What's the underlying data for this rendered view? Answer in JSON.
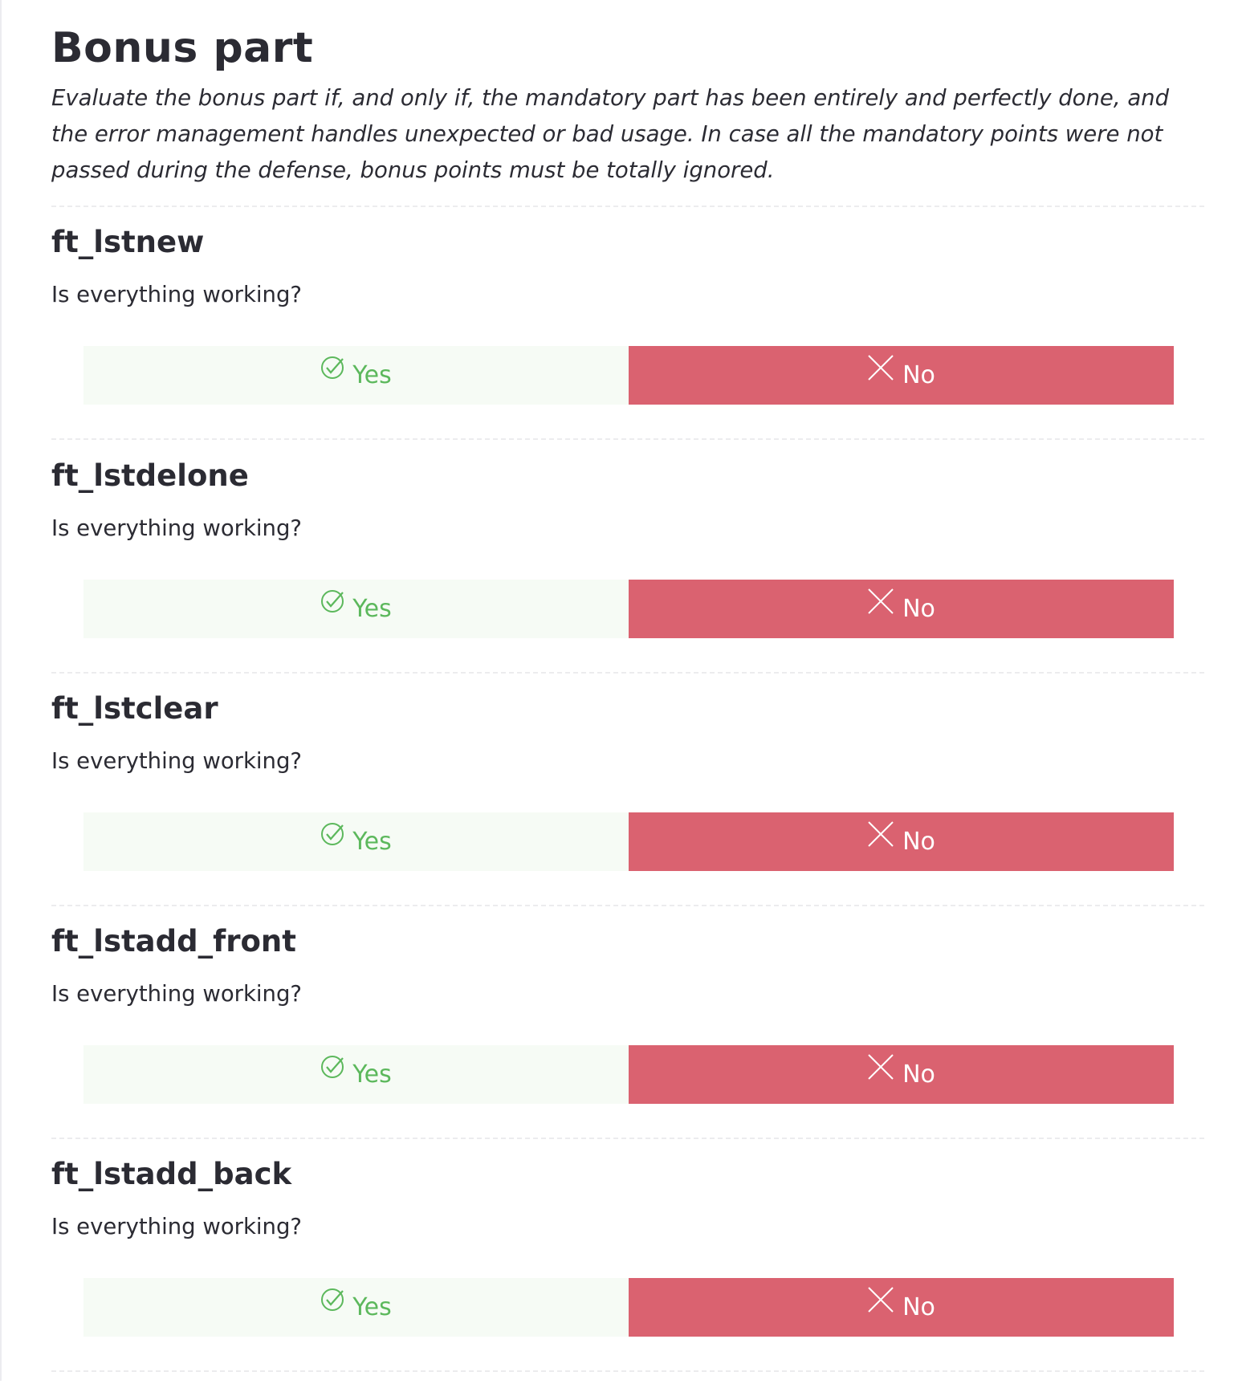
{
  "section": {
    "title": "Bonus part",
    "description": "Evaluate the bonus part if, and only if, the mandatory part has been entirely and perfectly done, and the error management handles unexpected or bad usage. In case all the mandatory points were not passed during the defense, bonus points must be totally ignored."
  },
  "questions": [
    {
      "title": "ft_lstnew",
      "text": "Is everything working?",
      "yes_label": "Yes",
      "no_label": "No",
      "yes_icon": "check-circle-icon",
      "no_icon": "close-x-icon"
    },
    {
      "title": "ft_lstdelone",
      "text": "Is everything working?",
      "yes_label": "Yes",
      "no_label": "No",
      "yes_icon": "check-circle-icon",
      "no_icon": "close-x-icon"
    },
    {
      "title": "ft_lstclear",
      "text": "Is everything working?",
      "yes_label": "Yes",
      "no_label": "No",
      "yes_icon": "check-circle-icon",
      "no_icon": "close-x-icon"
    },
    {
      "title": "ft_lstadd_front",
      "text": "Is everything working?",
      "yes_label": "Yes",
      "no_label": "No",
      "yes_icon": "check-circle-icon",
      "no_icon": "close-x-icon"
    },
    {
      "title": "ft_lstadd_back",
      "text": "Is everything working?",
      "yes_label": "Yes",
      "no_label": "No",
      "yes_icon": "check-circle-icon",
      "no_icon": "close-x-icon"
    }
  ],
  "colors": {
    "yes_text": "#5cb85c",
    "yes_bg": "#f6fbf5",
    "no_bg": "#da6270",
    "no_text": "#ffffff",
    "heading": "#2b2b33",
    "divider": "#ececee"
  }
}
